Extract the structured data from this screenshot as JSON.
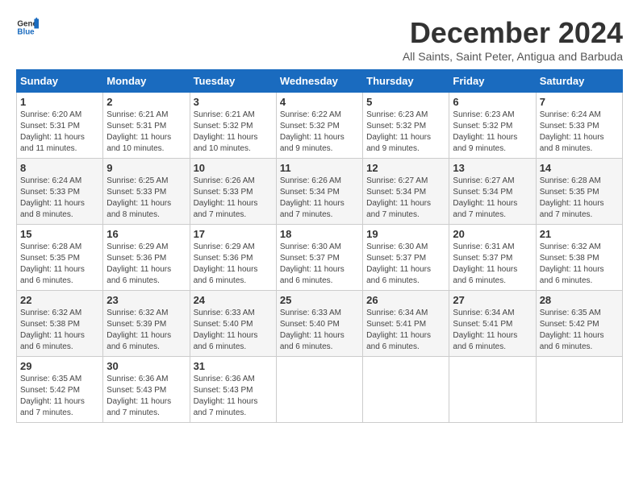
{
  "logo": {
    "text_general": "General",
    "text_blue": "Blue"
  },
  "header": {
    "month_title": "December 2024",
    "subtitle": "All Saints, Saint Peter, Antigua and Barbuda"
  },
  "calendar": {
    "weekdays": [
      "Sunday",
      "Monday",
      "Tuesday",
      "Wednesday",
      "Thursday",
      "Friday",
      "Saturday"
    ],
    "weeks": [
      [
        {
          "day": "1",
          "info": "Sunrise: 6:20 AM\nSunset: 5:31 PM\nDaylight: 11 hours\nand 11 minutes."
        },
        {
          "day": "2",
          "info": "Sunrise: 6:21 AM\nSunset: 5:31 PM\nDaylight: 11 hours\nand 10 minutes."
        },
        {
          "day": "3",
          "info": "Sunrise: 6:21 AM\nSunset: 5:32 PM\nDaylight: 11 hours\nand 10 minutes."
        },
        {
          "day": "4",
          "info": "Sunrise: 6:22 AM\nSunset: 5:32 PM\nDaylight: 11 hours\nand 9 minutes."
        },
        {
          "day": "5",
          "info": "Sunrise: 6:23 AM\nSunset: 5:32 PM\nDaylight: 11 hours\nand 9 minutes."
        },
        {
          "day": "6",
          "info": "Sunrise: 6:23 AM\nSunset: 5:32 PM\nDaylight: 11 hours\nand 9 minutes."
        },
        {
          "day": "7",
          "info": "Sunrise: 6:24 AM\nSunset: 5:33 PM\nDaylight: 11 hours\nand 8 minutes."
        }
      ],
      [
        {
          "day": "8",
          "info": "Sunrise: 6:24 AM\nSunset: 5:33 PM\nDaylight: 11 hours\nand 8 minutes."
        },
        {
          "day": "9",
          "info": "Sunrise: 6:25 AM\nSunset: 5:33 PM\nDaylight: 11 hours\nand 8 minutes."
        },
        {
          "day": "10",
          "info": "Sunrise: 6:26 AM\nSunset: 5:33 PM\nDaylight: 11 hours\nand 7 minutes."
        },
        {
          "day": "11",
          "info": "Sunrise: 6:26 AM\nSunset: 5:34 PM\nDaylight: 11 hours\nand 7 minutes."
        },
        {
          "day": "12",
          "info": "Sunrise: 6:27 AM\nSunset: 5:34 PM\nDaylight: 11 hours\nand 7 minutes."
        },
        {
          "day": "13",
          "info": "Sunrise: 6:27 AM\nSunset: 5:34 PM\nDaylight: 11 hours\nand 7 minutes."
        },
        {
          "day": "14",
          "info": "Sunrise: 6:28 AM\nSunset: 5:35 PM\nDaylight: 11 hours\nand 7 minutes."
        }
      ],
      [
        {
          "day": "15",
          "info": "Sunrise: 6:28 AM\nSunset: 5:35 PM\nDaylight: 11 hours\nand 6 minutes."
        },
        {
          "day": "16",
          "info": "Sunrise: 6:29 AM\nSunset: 5:36 PM\nDaylight: 11 hours\nand 6 minutes."
        },
        {
          "day": "17",
          "info": "Sunrise: 6:29 AM\nSunset: 5:36 PM\nDaylight: 11 hours\nand 6 minutes."
        },
        {
          "day": "18",
          "info": "Sunrise: 6:30 AM\nSunset: 5:37 PM\nDaylight: 11 hours\nand 6 minutes."
        },
        {
          "day": "19",
          "info": "Sunrise: 6:30 AM\nSunset: 5:37 PM\nDaylight: 11 hours\nand 6 minutes."
        },
        {
          "day": "20",
          "info": "Sunrise: 6:31 AM\nSunset: 5:37 PM\nDaylight: 11 hours\nand 6 minutes."
        },
        {
          "day": "21",
          "info": "Sunrise: 6:32 AM\nSunset: 5:38 PM\nDaylight: 11 hours\nand 6 minutes."
        }
      ],
      [
        {
          "day": "22",
          "info": "Sunrise: 6:32 AM\nSunset: 5:38 PM\nDaylight: 11 hours\nand 6 minutes."
        },
        {
          "day": "23",
          "info": "Sunrise: 6:32 AM\nSunset: 5:39 PM\nDaylight: 11 hours\nand 6 minutes."
        },
        {
          "day": "24",
          "info": "Sunrise: 6:33 AM\nSunset: 5:40 PM\nDaylight: 11 hours\nand 6 minutes."
        },
        {
          "day": "25",
          "info": "Sunrise: 6:33 AM\nSunset: 5:40 PM\nDaylight: 11 hours\nand 6 minutes."
        },
        {
          "day": "26",
          "info": "Sunrise: 6:34 AM\nSunset: 5:41 PM\nDaylight: 11 hours\nand 6 minutes."
        },
        {
          "day": "27",
          "info": "Sunrise: 6:34 AM\nSunset: 5:41 PM\nDaylight: 11 hours\nand 6 minutes."
        },
        {
          "day": "28",
          "info": "Sunrise: 6:35 AM\nSunset: 5:42 PM\nDaylight: 11 hours\nand 6 minutes."
        }
      ],
      [
        {
          "day": "29",
          "info": "Sunrise: 6:35 AM\nSunset: 5:42 PM\nDaylight: 11 hours\nand 7 minutes."
        },
        {
          "day": "30",
          "info": "Sunrise: 6:36 AM\nSunset: 5:43 PM\nDaylight: 11 hours\nand 7 minutes."
        },
        {
          "day": "31",
          "info": "Sunrise: 6:36 AM\nSunset: 5:43 PM\nDaylight: 11 hours\nand 7 minutes."
        },
        {
          "day": "",
          "info": ""
        },
        {
          "day": "",
          "info": ""
        },
        {
          "day": "",
          "info": ""
        },
        {
          "day": "",
          "info": ""
        }
      ]
    ]
  }
}
